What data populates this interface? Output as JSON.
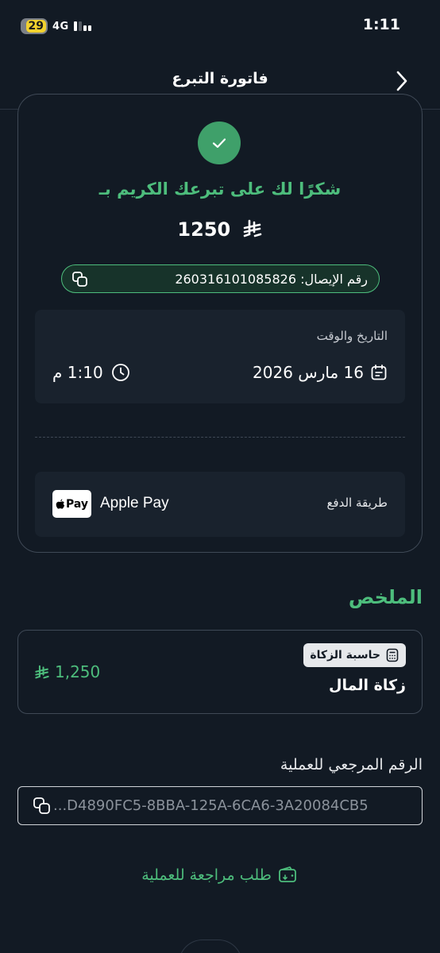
{
  "status_bar": {
    "battery": "29",
    "network": "4G",
    "time": "1:11"
  },
  "nav": {
    "title": "فاتورة التبرع"
  },
  "receipt": {
    "thanks_message": "شكرًا لك على تبرعك الكريم بـ",
    "amount": "1250",
    "currency_symbol": "⃁",
    "receipt_number_label": "رقم الإيصال: 26031610108582 6",
    "receipt_number_text": "رقم الإيصال: 260316101085826",
    "datetime_label": "التاريخ والوقت",
    "date": "16 مارس 2026",
    "time": "1:10 م",
    "payment_method_label": "طريقة الدفع",
    "payment_badge_text": "Pay",
    "payment_method": "Apple Pay"
  },
  "summary": {
    "title": "الملخص",
    "badge_label": "حاسبة الزكاة",
    "item_name": "زكاة المال",
    "item_amount": "1,250"
  },
  "reference": {
    "label": "الرقم المرجعي للعملية",
    "value": "...D4890FC5-8BBA-125A-6CA6-3A20084CB5"
  },
  "review_link": "طلب مراجعة للعملية",
  "colors": {
    "background": "#121a24",
    "accent_green": "#4dbd7c",
    "success_circle": "#3fa06a",
    "box_bg": "#19222d",
    "border": "#3f4956"
  }
}
